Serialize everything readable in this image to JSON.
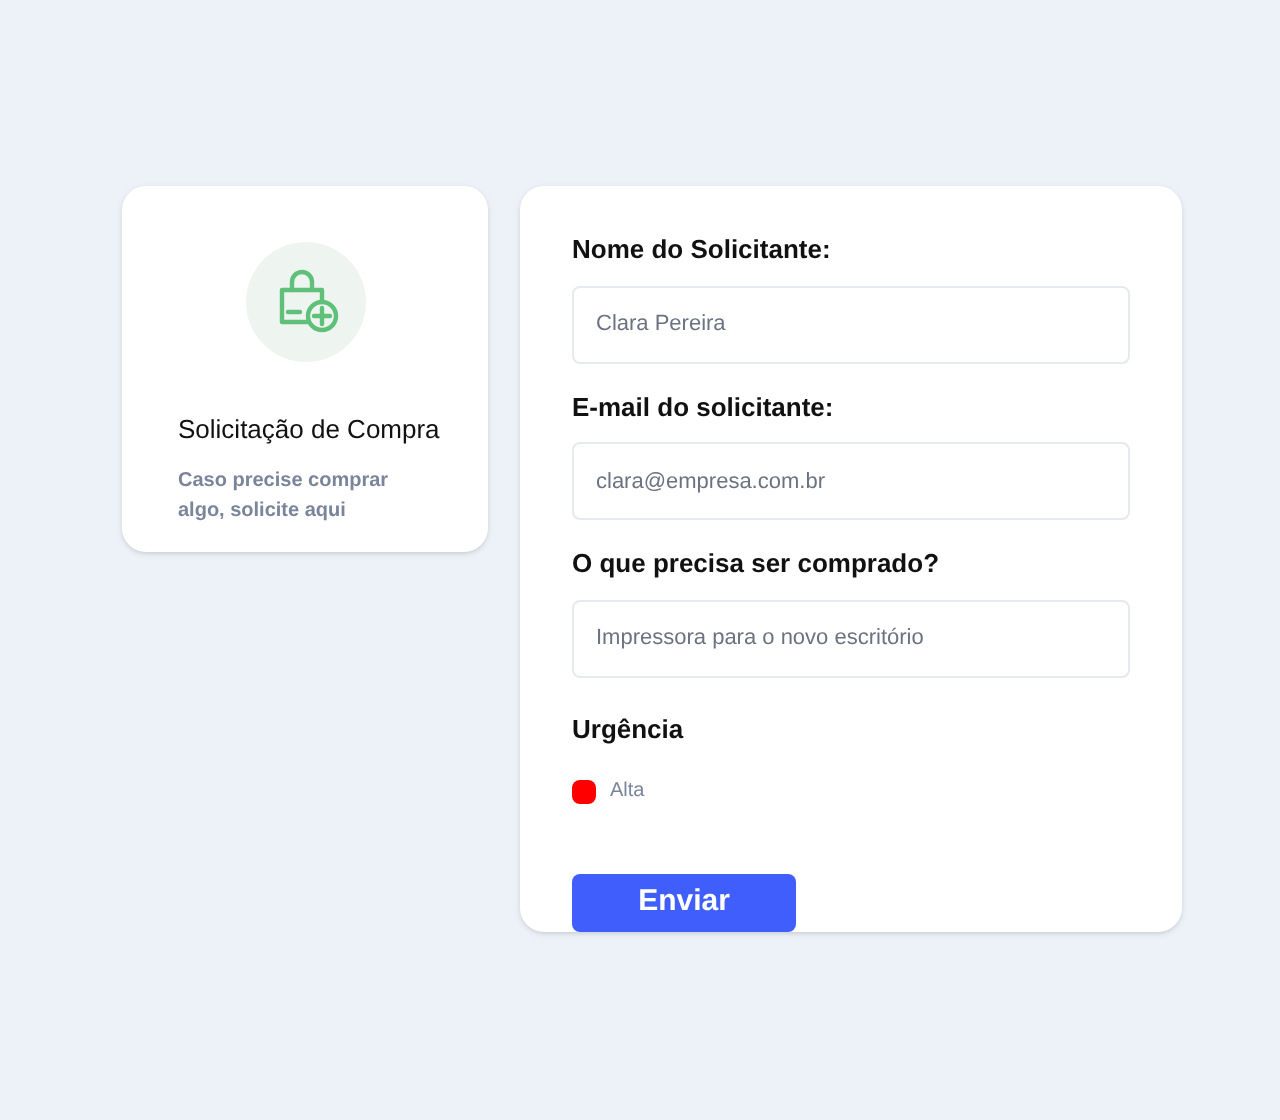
{
  "info_card": {
    "title": "Solicitação de Compra",
    "description": "Caso precise comprar algo, solicite aqui"
  },
  "form": {
    "fields": [
      {
        "label": "Nome do Solicitante:",
        "value": "Clara Pereira"
      },
      {
        "label": "E-mail do solicitante:",
        "value": "clara@empresa.com.br"
      },
      {
        "label": "O que precisa ser comprado?",
        "value": "Impressora para o novo escritório"
      }
    ],
    "urgency": {
      "label": "Urgência",
      "options": [
        {
          "label": "Alta",
          "color": "#ff0000"
        }
      ]
    },
    "submit": "Enviar"
  }
}
